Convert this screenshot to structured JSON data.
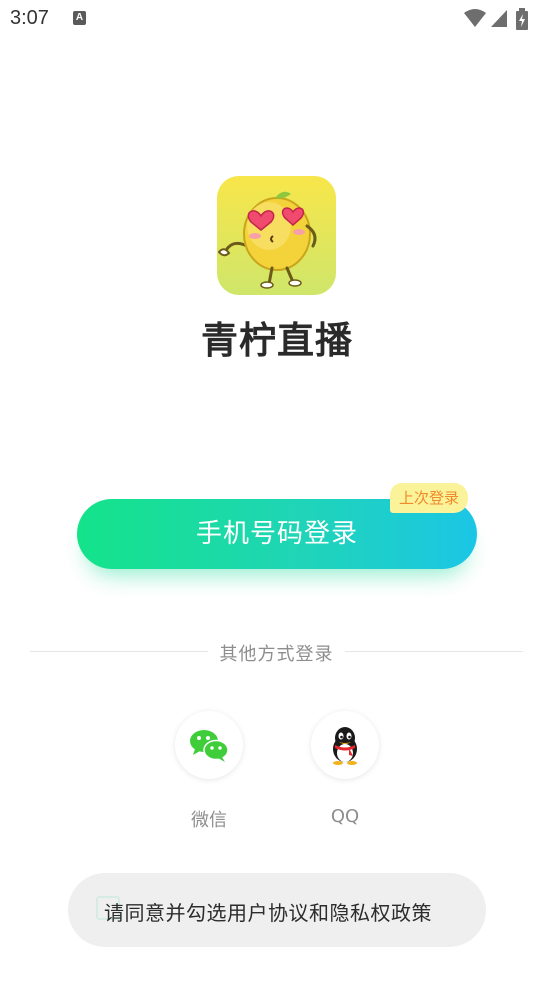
{
  "status_bar": {
    "time": "3:07",
    "notification_icon": "A"
  },
  "app": {
    "name": "青柠直播",
    "logo_icon": "lemon-mascot-icon"
  },
  "login": {
    "phone_button_label": "手机号码登录",
    "last_login_badge": "上次登录",
    "other_methods_label": "其他方式登录"
  },
  "social": {
    "wechat_label": "微信",
    "qq_label": "QQ"
  },
  "agreement": {
    "text": "请同意并勾选用户协议和隐私权政策"
  },
  "colors": {
    "button_gradient_start": "#14e38a",
    "button_gradient_end": "#1bc6e6",
    "badge_bg": "#fbf39a",
    "badge_text": "#f08a2a",
    "wechat_green": "#3fcd3a"
  }
}
